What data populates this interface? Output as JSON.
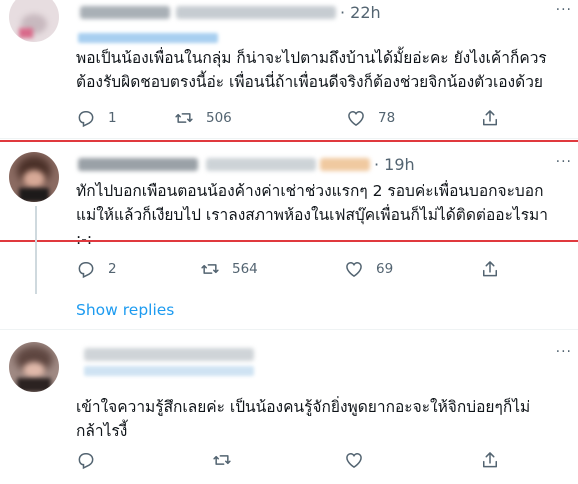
{
  "replies": [
    {
      "time": "· 22h",
      "text_lines": [
        "พอเป็นน้องเพื่อนในกลุ่ม ก็น่าจะไปตามถึงบ้านได้มั้ยอ่ะคะ ยังไงเค้าก็ควร",
        "ต้องรับผิดชอบตรงนี้อ่ะ เพื่อนนี่ถ้าเพื่อนดีจริงก็ต้องช่วยจิกน้องตัวเองด้วย"
      ],
      "reply_count": "1",
      "retweet_count": "506",
      "like_count": "78"
    },
    {
      "time": "· 19h",
      "text_lines": [
        "ทักไปบอกเพือนตอนน้องค้างค่าเช่าช่วงแรกๆ 2 รอบค่ะเพื่อนบอกจะบอก",
        "แม่ให้แล้วก็เงียบไป เราลงสภาพห้องในเฟสบุ๊คเพื่อนก็ไม่ได้ติดต่ออะไรมา",
        ":-:"
      ],
      "reply_count": "2",
      "retweet_count": "564",
      "like_count": "69"
    },
    {
      "time": "",
      "text_lines": [
        "เข้าใจความรู้สึกเลยค่ะ เป็นน้องคนรู้จักยิ่งพูดยากอะจะให้จิกบ่อยๆก็ไม่",
        "กล้าไรงี้"
      ],
      "reply_count": "",
      "retweet_count": "",
      "like_count": ""
    }
  ],
  "show_replies_label": "Show replies",
  "more_label": "···",
  "icons": [
    "reply-icon",
    "retweet-icon",
    "like-icon",
    "share-icon",
    "more-icon"
  ],
  "colors": {
    "accent": "#1d9bf0",
    "highlight": "#e0393e",
    "muted": "#536471"
  }
}
